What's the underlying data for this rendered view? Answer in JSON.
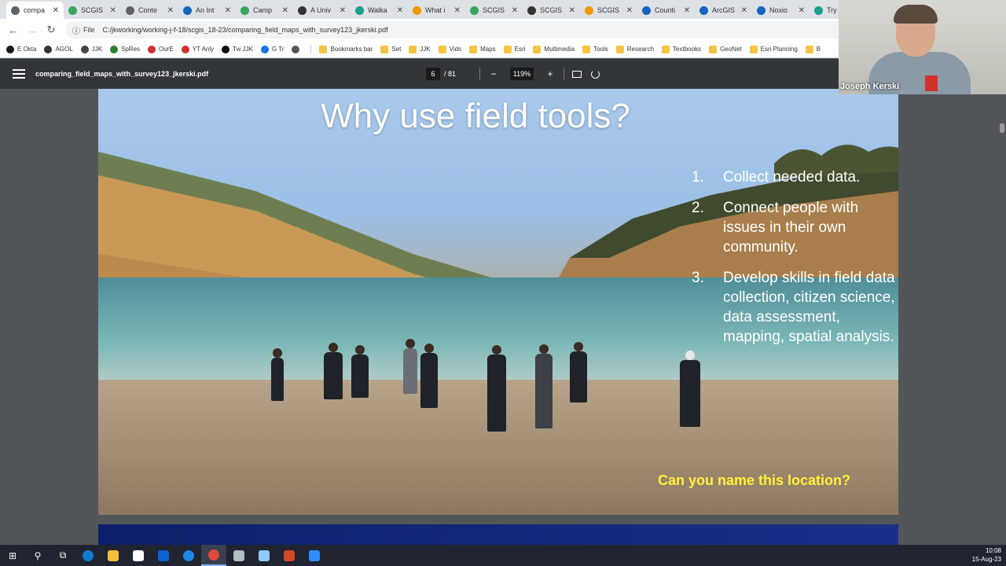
{
  "browser": {
    "tabs": [
      {
        "label": "compa",
        "fav_color": "#5f6368",
        "active": true
      },
      {
        "label": "SCGIS",
        "fav_color": "#3ba55c"
      },
      {
        "label": "Conte",
        "fav_color": "#5f6368"
      },
      {
        "label": "An Int",
        "fav_color": "#1565c0"
      },
      {
        "label": "Camp",
        "fav_color": "#3ba55c"
      },
      {
        "label": "A Univ",
        "fav_color": "#333"
      },
      {
        "label": "Walka",
        "fav_color": "#1a9e8f"
      },
      {
        "label": "What i",
        "fav_color": "#f29900"
      },
      {
        "label": "SCGIS",
        "fav_color": "#3ba55c"
      },
      {
        "label": "SCGIS",
        "fav_color": "#333"
      },
      {
        "label": "SCGIS",
        "fav_color": "#f29900"
      },
      {
        "label": "Counti",
        "fav_color": "#1565c0"
      },
      {
        "label": "ArcGIS",
        "fav_color": "#1565c0"
      },
      {
        "label": "Noxio",
        "fav_color": "#1565c0"
      },
      {
        "label": "Try A",
        "fav_color": "#1a9e8f"
      }
    ],
    "address": {
      "prefix": "File",
      "url": "C:/jkworking/working-j-f-18/scgis_18-23/comparing_field_maps_with_survey123_jkerski.pdf"
    },
    "bookmarks": [
      {
        "label": "E Okta",
        "color": "#1a1a1a"
      },
      {
        "label": "AGOL",
        "color": "#333"
      },
      {
        "label": "JJK",
        "color": "#444"
      },
      {
        "label": "SpRes",
        "color": "#2e7d32"
      },
      {
        "label": "OurE",
        "color": "#d32f2f"
      },
      {
        "label": "YT Anly",
        "color": "#d32f2f"
      },
      {
        "label": "Tw JJK",
        "color": "#111"
      },
      {
        "label": "G Tr",
        "color": "#1a73e8"
      },
      {
        "label": "",
        "color": "#555"
      },
      {
        "label": "Bookmarks bar",
        "folder": true
      },
      {
        "label": "Set",
        "folder": true
      },
      {
        "label": "JJK",
        "folder": true
      },
      {
        "label": "Vids",
        "folder": true
      },
      {
        "label": "Maps",
        "folder": true
      },
      {
        "label": "Esri",
        "folder": true
      },
      {
        "label": "Multimedia",
        "folder": true
      },
      {
        "label": "Tools",
        "folder": true
      },
      {
        "label": "Research",
        "folder": true
      },
      {
        "label": "Textbooks",
        "folder": true
      },
      {
        "label": "GeoNet",
        "folder": true
      },
      {
        "label": "Esri Planning",
        "folder": true
      },
      {
        "label": "B",
        "folder": true
      }
    ]
  },
  "pdf": {
    "filename": "comparing_field_maps_with_survey123_jkerski.pdf",
    "page": "6",
    "total": "/ 81",
    "zoom": "119%"
  },
  "slide": {
    "title": "Why use field tools?",
    "points": [
      {
        "num": "1.",
        "text": "Collect needed data."
      },
      {
        "num": "2.",
        "text": "Connect people with issues in their own community."
      },
      {
        "num": "3.",
        "text": "Develop skills in field data collection, citizen science, data assessment, mapping, spatial analysis."
      }
    ],
    "question": "Can you name this location?"
  },
  "webcam": {
    "name": "Joseph Kerski"
  },
  "taskbar": {
    "apps": [
      {
        "name": "windows-start",
        "glyph": "⊞"
      },
      {
        "name": "search",
        "glyph": "⚲"
      },
      {
        "name": "task-view",
        "glyph": "⧉"
      },
      {
        "name": "edge",
        "color": "#0f7bd1"
      },
      {
        "name": "file-explorer",
        "color": "#f2c037"
      },
      {
        "name": "store",
        "color": "#ffffff"
      },
      {
        "name": "outlook",
        "color": "#0a64d1"
      },
      {
        "name": "app",
        "color": "#1e88e5"
      },
      {
        "name": "chrome",
        "color": "#e0483a",
        "active": true
      },
      {
        "name": "app2",
        "color": "#b0bec5"
      },
      {
        "name": "app3",
        "color": "#90caf9"
      },
      {
        "name": "powerpoint",
        "color": "#d24726"
      },
      {
        "name": "zoom",
        "color": "#2d8cff"
      }
    ],
    "time": "10:08",
    "date": "15-Aug-23"
  }
}
